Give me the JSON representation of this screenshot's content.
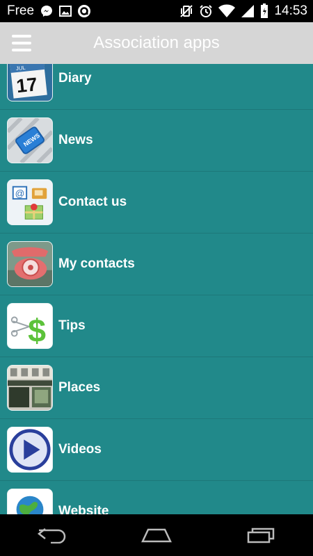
{
  "status_bar": {
    "carrier": "Free",
    "time": "14:53",
    "icons": [
      "messenger-icon",
      "image-icon",
      "app-notification-icon",
      "vibrate-icon",
      "alarm-icon",
      "wifi-icon",
      "signal-icon",
      "battery-icon"
    ]
  },
  "app_bar": {
    "title": "Association apps",
    "menu_icon": "hamburger-menu-icon"
  },
  "menu_items": [
    {
      "label": "Diary",
      "icon": "calendar-icon"
    },
    {
      "label": "News",
      "icon": "news-key-icon"
    },
    {
      "label": "Contact us",
      "icon": "contact-icon"
    },
    {
      "label": "My contacts",
      "icon": "rotary-phone-icon"
    },
    {
      "label": "Tips",
      "icon": "dollar-tips-icon"
    },
    {
      "label": "Places",
      "icon": "storefront-icon"
    },
    {
      "label": "Videos",
      "icon": "play-icon"
    },
    {
      "label": "Website",
      "icon": "globe-icon"
    }
  ],
  "nav_bar": {
    "icons": [
      "back-icon",
      "home-icon",
      "recents-icon"
    ]
  },
  "colors": {
    "list_background": "#21898a",
    "app_bar": "#d6d6d6",
    "status_bar": "#000000"
  }
}
